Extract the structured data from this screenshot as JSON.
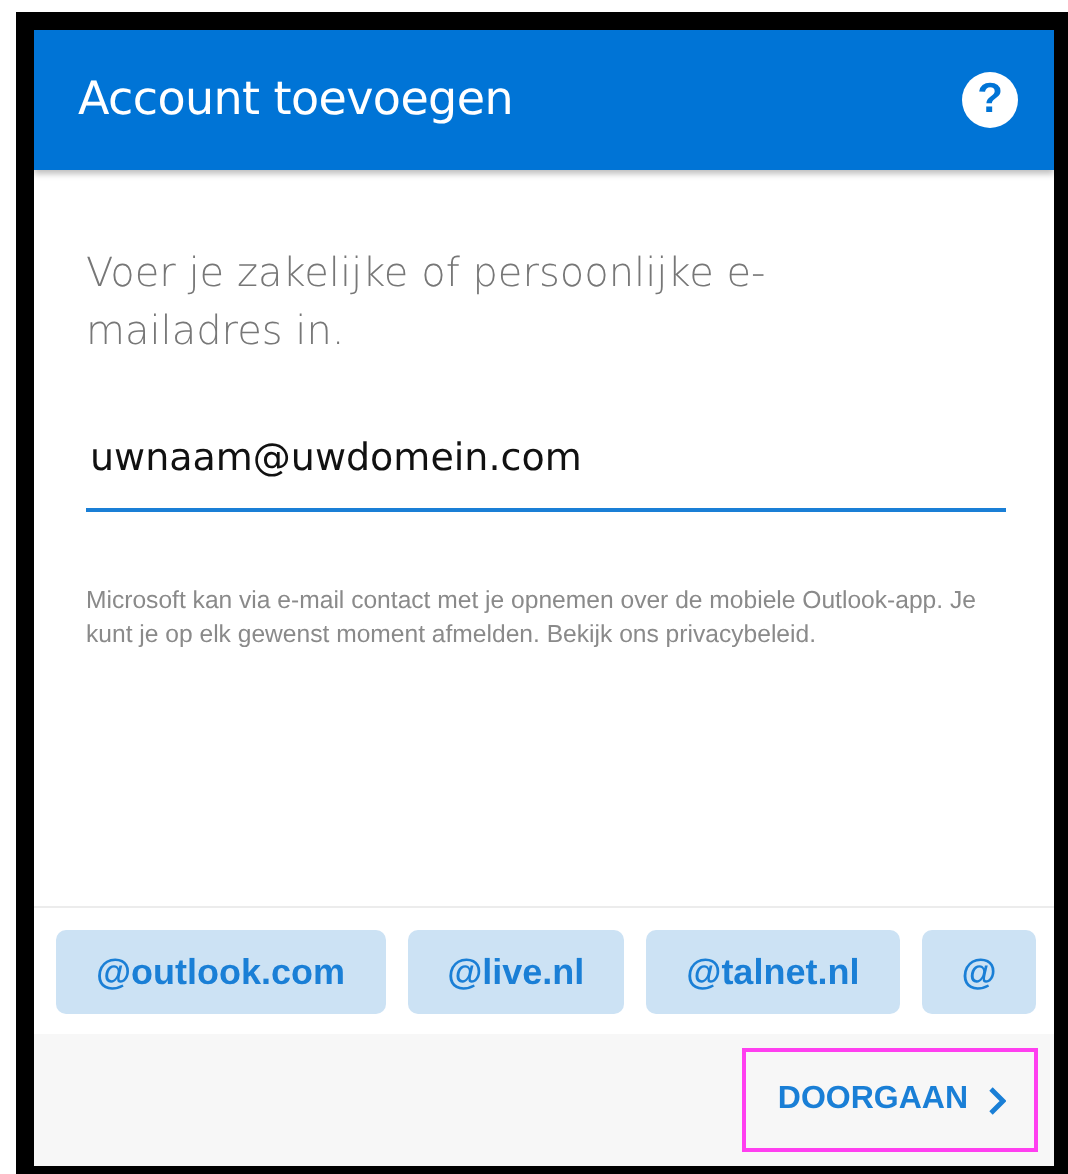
{
  "header": {
    "title": "Account toevoegen",
    "help": "?"
  },
  "prompt": "Voer je zakelijke of persoonlijke e-mailadres in.",
  "email_field": {
    "value": "uwnaam@uwdomein.com",
    "focused": true
  },
  "disclaimer": "Microsoft kan via e-mail contact met je opnemen over de mobiele Outlook-app. Je kunt je op elk gewenst moment afmelden. Bekijk ons privacybeleid.",
  "domain_chips": [
    {
      "label": "@outlook.com"
    },
    {
      "label": "@live.nl"
    },
    {
      "label": "@talnet.nl"
    },
    {
      "label": "@"
    }
  ],
  "continue_button": {
    "label": "DOORGAAN",
    "highlighted": true
  }
}
